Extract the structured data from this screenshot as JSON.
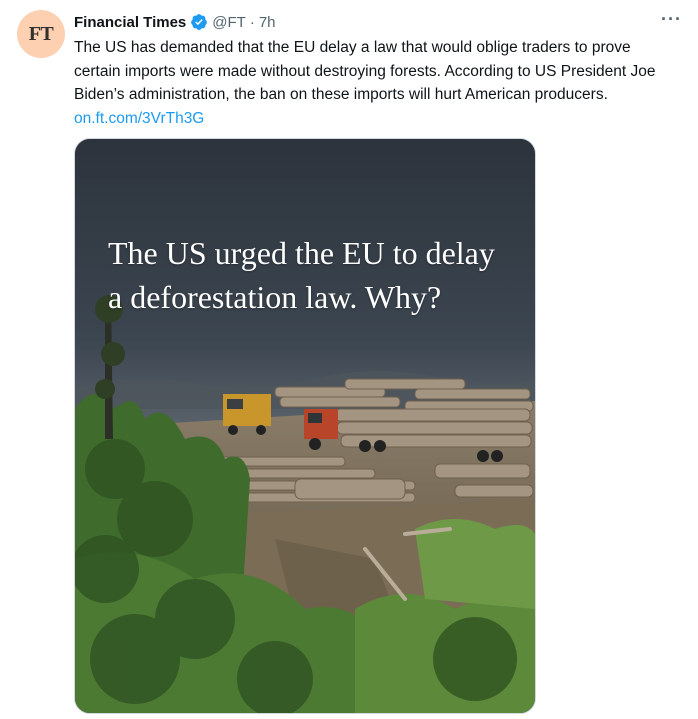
{
  "author": {
    "avatar_text": "FT",
    "name": "Financial Times",
    "handle": "@FT",
    "separator": "·",
    "time": "7h"
  },
  "more_label": "···",
  "tweet": {
    "text": "The US has demanded that the EU delay a law that would oblige traders to prove certain imports were made without destroying forests. According to US President Joe Biden’s administration, the ban on these imports will hurt American producers.",
    "link": "on.ft.com/3VrTh3G"
  },
  "media": {
    "headline_line1": "The US urged the EU to delay",
    "headline_line2": "a deforestation law. Why?"
  },
  "colors": {
    "link": "#1d9bf0",
    "verified": "#1d9bf0",
    "avatar_bg": "#fcd0b1"
  }
}
